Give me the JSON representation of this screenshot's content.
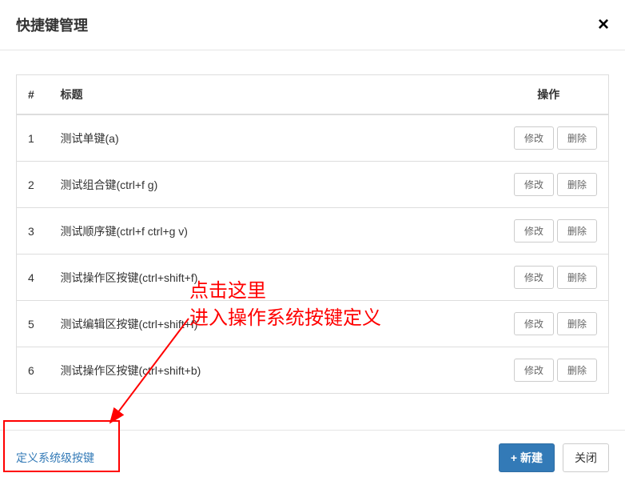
{
  "header": {
    "title": "快捷键管理"
  },
  "table": {
    "columns": {
      "index": "#",
      "title": "标题",
      "actions": "操作"
    },
    "edit_label": "修改",
    "delete_label": "删除",
    "rows": [
      {
        "idx": "1",
        "title": "测试单键(a)"
      },
      {
        "idx": "2",
        "title": "测试组合键(ctrl+f g)"
      },
      {
        "idx": "3",
        "title": "测试顺序键(ctrl+f ctrl+g v)"
      },
      {
        "idx": "4",
        "title": "测试操作区按键(ctrl+shift+f)"
      },
      {
        "idx": "5",
        "title": "测试编辑区按键(ctrl+shift+f)"
      },
      {
        "idx": "6",
        "title": "测试操作区按键(ctrl+shift+b)"
      }
    ]
  },
  "footer": {
    "define_link": "定义系统级按键",
    "new_label": "+ 新建",
    "close_label": "关闭"
  },
  "annotation": {
    "line1": "点击这里",
    "line2": "进入操作系统按键定义"
  }
}
